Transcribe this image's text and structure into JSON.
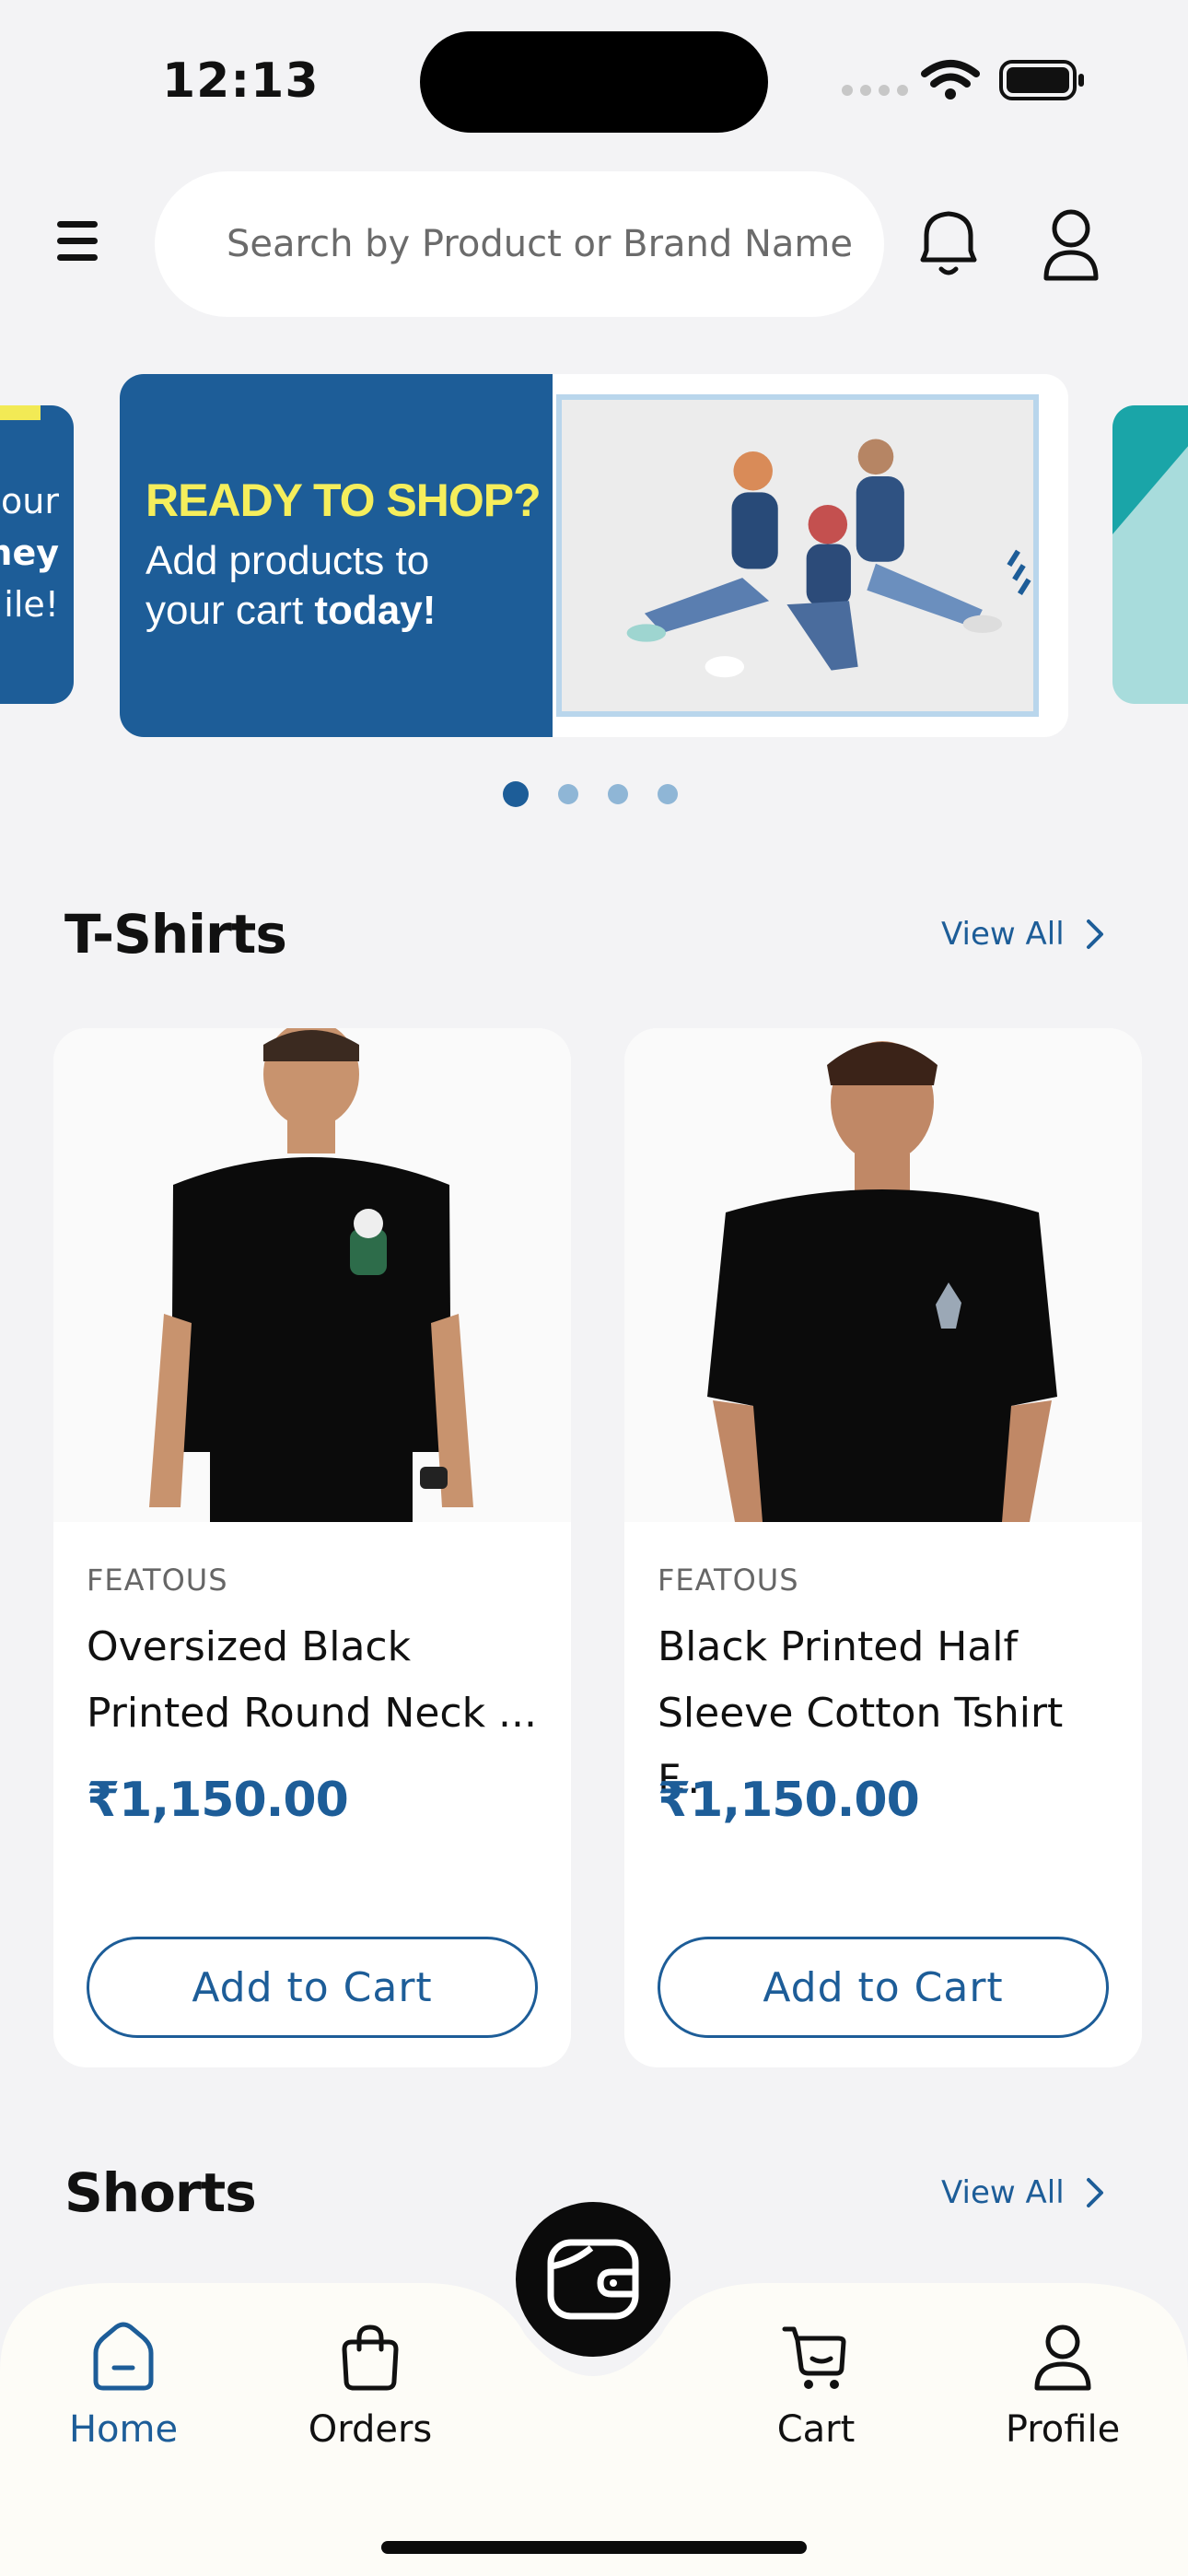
{
  "status_bar": {
    "time": "12:13"
  },
  "header": {
    "search_placeholder": "Search by Product or Brand Name"
  },
  "banner": {
    "headline": "READY TO SHOP?",
    "line1": "Add products to",
    "line2_prefix": "your cart ",
    "line2_bold": "today!",
    "left_peek_lines": [
      "our",
      "ney",
      "ile!"
    ],
    "active_page": 1,
    "page_count": 4
  },
  "sections": [
    {
      "title": "T-Shirts",
      "view_all": "View All"
    },
    {
      "title": "Shorts",
      "view_all": "View All"
    }
  ],
  "products": [
    {
      "brand": "FEATOUS",
      "name": "Oversized Black Printed Round Neck ...",
      "price": "₹1,150.00",
      "cta": "Add to Cart"
    },
    {
      "brand": "FEATOUS",
      "name": "Black Printed Half Sleeve Cotton Tshirt F...",
      "price": "₹1,150.00",
      "cta": "Add to Cart"
    }
  ],
  "bottom_nav": {
    "items": [
      {
        "label": "Home",
        "icon": "home-icon",
        "active": true
      },
      {
        "label": "Orders",
        "icon": "bag-icon",
        "active": false
      },
      {
        "label": "Cart",
        "icon": "cart-icon",
        "active": false
      },
      {
        "label": "Profile",
        "icon": "user-icon",
        "active": false
      }
    ],
    "fab_icon": "wallet-icon"
  },
  "colors": {
    "brand": "#1d5d98",
    "accent_yellow": "#f5ee5c",
    "background": "#f3f3f5"
  }
}
